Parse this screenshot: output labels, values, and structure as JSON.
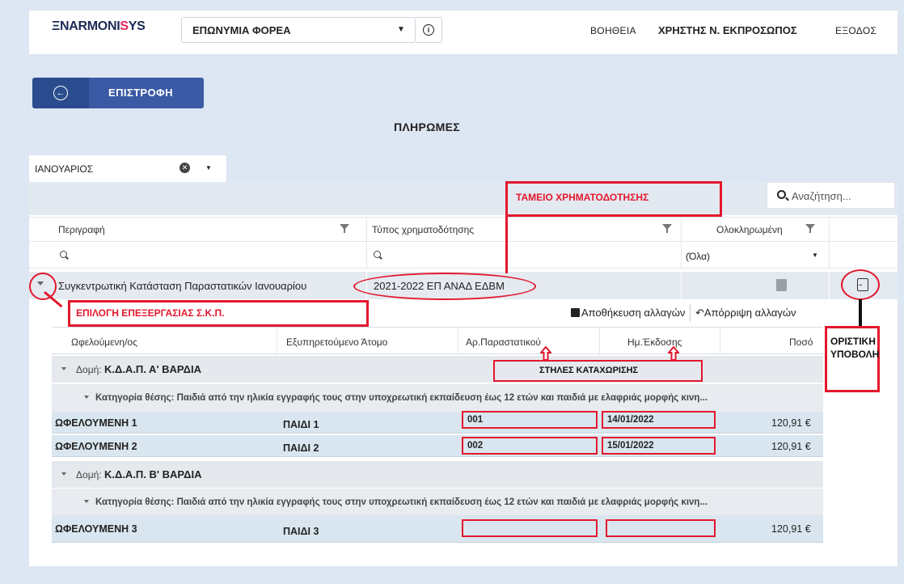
{
  "header": {
    "logo_prefix": "Ξ",
    "logo_text": "NARMONI",
    "logo_accent": "S",
    "logo_suffix": "YS",
    "org_select": "ΕΠΩΝΥΜΙΑ ΦΟΡΕΑ",
    "help": "ΒΟΗΘΕΙΑ",
    "user": "ΧΡΗΣΤΗΣ Ν. ΕΚΠΡΟΣΩΠΟΣ",
    "exit": "ΕΞΟΔΟΣ"
  },
  "back_label": "ΕΠΙΣΤΡΟΦΗ",
  "page_title": "ΠΛΗΡΩΜΕΣ",
  "month_select": "ΙΑΝΟΥΑΡΙΟΣ",
  "search_placeholder": "Αναζήτηση...",
  "columns": {
    "description": "Περιγραφή",
    "funding_type": "Τύπος χρηματοδότησης",
    "completed": "Ολοκληρωμένη"
  },
  "completed_filter": "(Όλα)",
  "main_row": {
    "description": "Συγκεντρωτική Κατάσταση Παραστατικών Ιανουαρίου",
    "funding_type": "2021-2022 ΕΠ ΑΝΑΔ ΕΔΒΜ"
  },
  "actions": {
    "save": "Αποθήκευση αλλαγών",
    "discard": "Απόρριψη αλλαγών"
  },
  "grid_columns": [
    "Ωφελούμενη/ος",
    "Εξυπηρετούμενο Άτομο",
    "Αρ.Παραστατικού",
    "Ημ.Έκδοσης",
    "Ποσό"
  ],
  "groups": [
    {
      "label": "Δομή:",
      "name": "Κ.Δ.Α.Π. Α' ΒΑΡΔΙΑ",
      "category": "Κατηγορία θέσης: Παιδιά από την ηλικία εγγραφής τους στην υποχρεωτική εκπαίδευση έως 12 ετών και παιδιά με ελαφριάς μορφής κινη...",
      "rows": [
        {
          "beneficiary": "ΩΦΕΛΟΥΜΕΝΗ 1",
          "person": "ΠΑΙΔΙ 1",
          "doc_no": "001",
          "date": "14/01/2022",
          "amount": "120,91 €"
        },
        {
          "beneficiary": "ΩΦΕΛΟΥΜΕΝΗ 2",
          "person": "ΠΑΙΔΙ 2",
          "doc_no": "002",
          "date": "15/01/2022",
          "amount": "120,91 €"
        }
      ]
    },
    {
      "label": "Δομή:",
      "name": "Κ.Δ.Α.Π. Β' ΒΑΡΔΙΑ",
      "category": "Κατηγορία θέσης: Παιδιά από την ηλικία εγγραφής τους στην υποχρεωτική εκπαίδευση έως 12 ετών και παιδιά με ελαφριάς μορφής κινη...",
      "rows": [
        {
          "beneficiary": "ΩΦΕΛΟΥΜΕΝΗ 3",
          "person": "ΠΑΙΔΙ 3",
          "doc_no": "",
          "date": "",
          "amount": "120,91 €"
        }
      ]
    }
  ],
  "annotations": {
    "funding_source": "ΤΑΜΕΙΟ ΧΡΗΜΑΤΟΔΟΤΗΣΗΣ",
    "select_edit": "ΕΠΙΛΟΓΗ ΕΠΕΞΕΡΓΑΣΙΑΣ Σ.Κ.Π.",
    "entry_columns": "ΣΤΗΛΕΣ ΚΑΤΑΧΩΡΙΣΗΣ",
    "final_submit_1": "ΟΡΙΣΤΙΚΗ",
    "final_submit_2": "ΥΠΟΒΟΛΗ"
  },
  "colors": {
    "annotation": "#e3182d",
    "brand": "#2a4c8e"
  }
}
